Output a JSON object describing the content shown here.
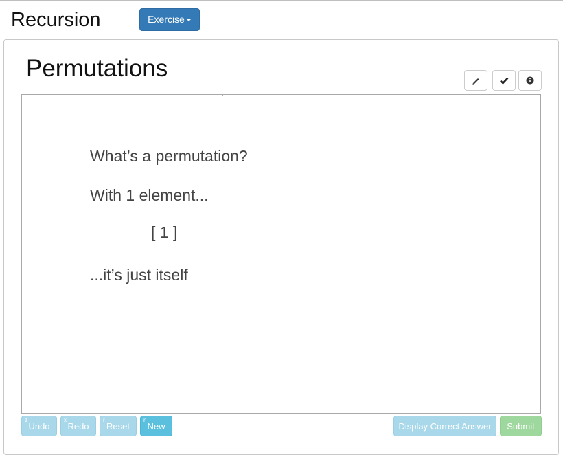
{
  "header": {
    "title": "Recursion",
    "exercise_button": "Exercise"
  },
  "exercise": {
    "title": "Permutations",
    "toolbar_icons": [
      "pencil-icon",
      "checkmark-icon",
      "info-circle-icon"
    ]
  },
  "slide": {
    "line1": "What’s a permutation?",
    "line2": "With 1 element...",
    "line3": "[ 1 ]",
    "line4": "...it’s just itself"
  },
  "controls": {
    "undo": {
      "key": "z",
      "label": "Undo"
    },
    "redo": {
      "key": "x",
      "label": "Redo"
    },
    "reset": {
      "key": "r",
      "label": "Reset"
    },
    "new": {
      "key": "n",
      "label": "New"
    },
    "display_answer": "Display Correct Answer",
    "submit": "Submit"
  },
  "colors": {
    "primary_button": "#337ab7",
    "info_button": "#5bc0de",
    "disabled_info_button": "#a8d8ea",
    "disabled_success_button": "#9fd89f"
  }
}
